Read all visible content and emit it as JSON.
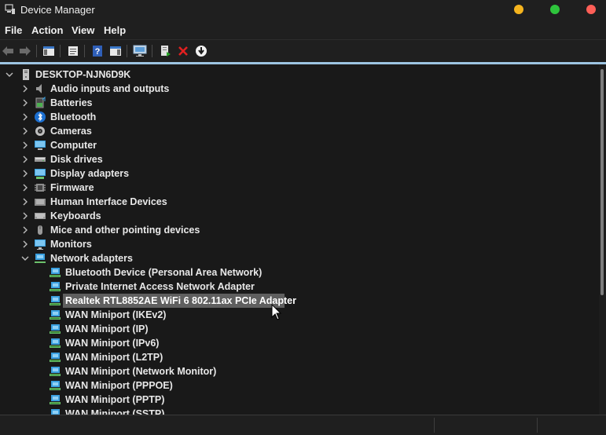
{
  "window": {
    "title": "Device Manager",
    "traffic_colors": [
      "#f5b41e",
      "#2ec43c",
      "#ff5f57"
    ]
  },
  "menu": [
    "File",
    "Action",
    "View",
    "Help"
  ],
  "toolbar": [
    "back-icon",
    "forward-icon",
    "show-hide-console-tree-icon",
    "properties-icon",
    "help-icon",
    "action-pane-icon",
    "monitor-icon",
    "update-driver-icon",
    "uninstall-icon",
    "download-icon"
  ],
  "tree": {
    "root": "DESKTOP-NJN6D9K",
    "categories": [
      {
        "label": "Audio inputs and outputs",
        "icon": "speaker-icon"
      },
      {
        "label": "Batteries",
        "icon": "battery-icon"
      },
      {
        "label": "Bluetooth",
        "icon": "bluetooth-icon"
      },
      {
        "label": "Cameras",
        "icon": "camera-icon"
      },
      {
        "label": "Computer",
        "icon": "computer-icon"
      },
      {
        "label": "Disk drives",
        "icon": "disk-drive-icon"
      },
      {
        "label": "Display adapters",
        "icon": "display-adapter-icon"
      },
      {
        "label": "Firmware",
        "icon": "firmware-icon"
      },
      {
        "label": "Human Interface Devices",
        "icon": "hid-icon"
      },
      {
        "label": "Keyboards",
        "icon": "keyboard-icon"
      },
      {
        "label": "Mice and other pointing devices",
        "icon": "mouse-icon"
      },
      {
        "label": "Monitors",
        "icon": "monitor-icon"
      }
    ],
    "expanded": {
      "label": "Network adapters",
      "icon": "network-adapter-icon",
      "children": [
        "Bluetooth Device (Personal Area Network)",
        "Private Internet Access Network Adapter",
        "Realtek RTL8852AE WiFi 6 802.11ax PCIe Adapter",
        "WAN Miniport (IKEv2)",
        "WAN Miniport (IP)",
        "WAN Miniport (IPv6)",
        "WAN Miniport (L2TP)",
        "WAN Miniport (Network Monitor)",
        "WAN Miniport (PPPOE)",
        "WAN Miniport (PPTP)",
        "WAN Miniport (SSTP)"
      ],
      "selected": "Realtek RTL8852AE WiFi 6 802.11ax PCIe Adapter"
    }
  },
  "colors": {
    "selection": "#5f5f5f",
    "accent_strip": "#9dc4e2",
    "network_icon": "#3aa0e0"
  }
}
